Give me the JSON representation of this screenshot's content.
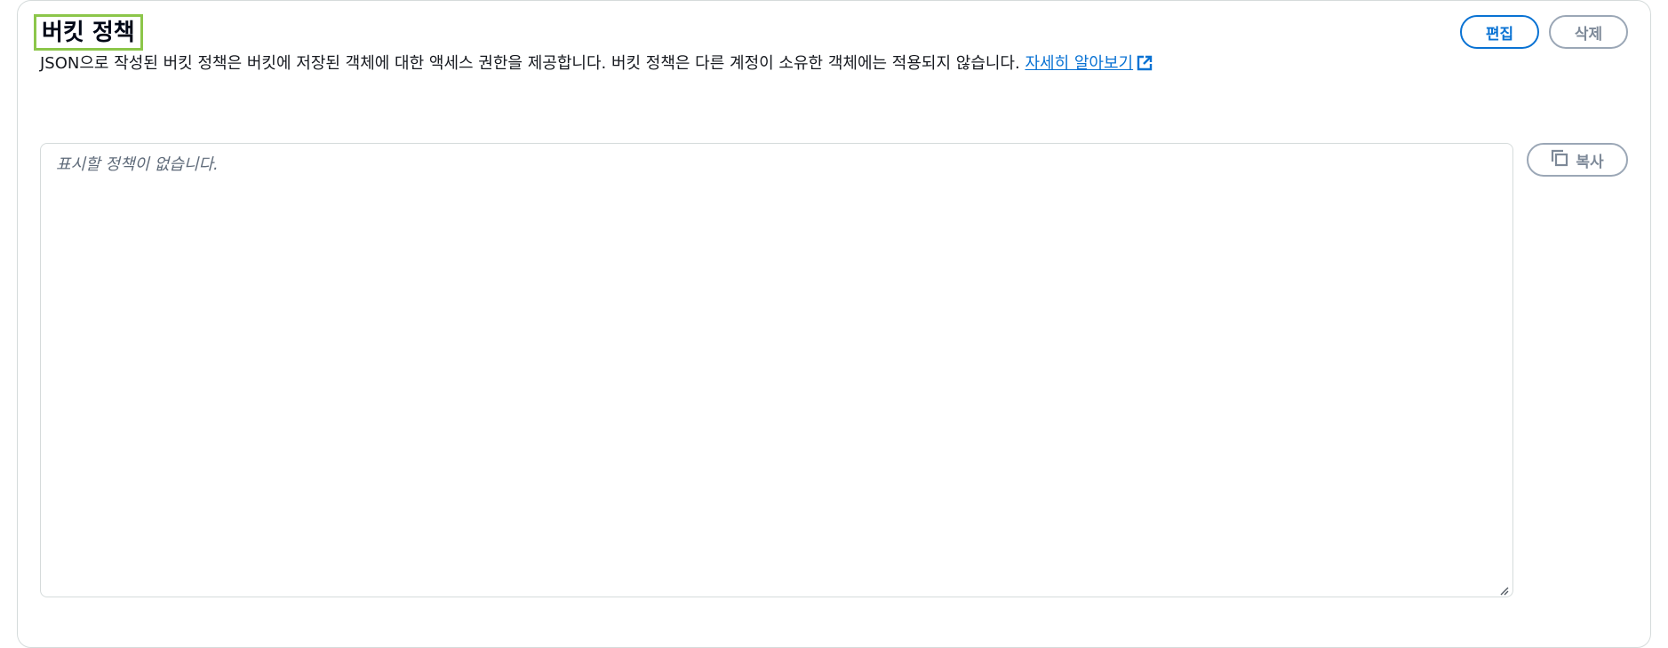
{
  "section": {
    "title": "버킷 정책",
    "description": "JSON으로 작성된 버킷 정책은 버킷에 저장된 객체에 대한 액세스 권한을 제공합니다. 버킷 정책은 다른 계정이 소유한 객체에는 적용되지 않습니다.",
    "learn_more_label": "자세히 알아보기"
  },
  "actions": {
    "edit_label": "편집",
    "delete_label": "삭제",
    "copy_label": "복사"
  },
  "policy": {
    "placeholder": "표시할 정책이 없습니다."
  },
  "icons": {
    "external_link": "external-link-icon",
    "copy": "copy-icon",
    "resize": "resize-handle-icon"
  },
  "colors": {
    "link": "#0972d3",
    "title_highlight": "#8cc64a",
    "disabled": "#7d8998",
    "border": "#d5dbdb"
  }
}
